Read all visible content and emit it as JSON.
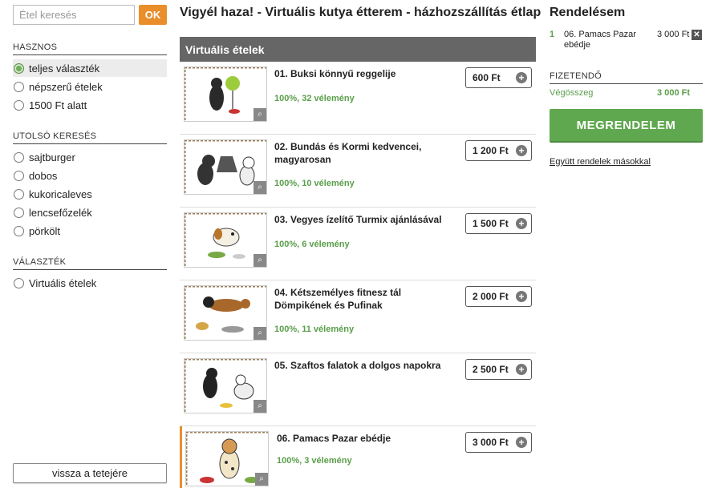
{
  "search": {
    "placeholder": "Étel keresés",
    "button_label": "OK"
  },
  "filters": [
    {
      "title": "HASZNOS",
      "items": [
        {
          "label": "teljes választék",
          "checked": true
        },
        {
          "label": "népszerű ételek",
          "checked": false
        },
        {
          "label": "1500 Ft alatt",
          "checked": false
        }
      ]
    },
    {
      "title": "UTOLSÓ KERESÉS",
      "items": [
        {
          "label": "sajtburger",
          "checked": false
        },
        {
          "label": "dobos",
          "checked": false
        },
        {
          "label": "kukoricaleves",
          "checked": false
        },
        {
          "label": "lencsefőzelék",
          "checked": false
        },
        {
          "label": "pörkölt",
          "checked": false
        }
      ]
    },
    {
      "title": "VÁLASZTÉK",
      "items": [
        {
          "label": "Virtuális ételek",
          "checked": false
        }
      ]
    }
  ],
  "back_to_top": "vissza a tetejére",
  "page_title": "Vigyél haza! - Virtuális kutya étterem - házhozszállítás étlap",
  "category": "Virtuális ételek",
  "menu": [
    {
      "name": "01. Buksi könnyű reggelije",
      "rating": "100%, 32 vélemény",
      "price": "600 Ft"
    },
    {
      "name": "02. Bundás és Kormi kedvencei, magyarosan",
      "rating": "100%, 10 vélemény",
      "price": "1 200 Ft"
    },
    {
      "name": "03. Vegyes ízelítő Turmix ajánlásával",
      "rating": "100%, 6 vélemény",
      "price": "1 500 Ft"
    },
    {
      "name": "04. Kétszemélyes fitnesz tál Dömpikének és Pufinak",
      "rating": "100%, 11 vélemény",
      "price": "2 000 Ft"
    },
    {
      "name": "05. Szaftos falatok a dolgos napokra",
      "rating": "",
      "price": "2 500 Ft"
    },
    {
      "name": "06. Pamacs Pazar ebédje",
      "rating": "100%, 3 vélemény",
      "price": "3 000 Ft"
    }
  ],
  "order": {
    "title": "Rendelésem",
    "line": {
      "qty": "1",
      "name": "06. Pamacs Pazar ebédje",
      "price": "3 000 Ft"
    },
    "payable_title": "FIZETENDŐ",
    "total_label": "Végösszeg",
    "total_value": "3 000 Ft",
    "order_button": "MEGRENDELEM",
    "together_link": "Együtt rendelek másokkal"
  },
  "colors": {
    "accent": "#e98e2b",
    "green": "#5fa84f",
    "category_bar": "#666666"
  },
  "icons": {
    "zoom": "magnifier-icon",
    "add": "plus-circle-icon",
    "remove": "close-icon"
  }
}
